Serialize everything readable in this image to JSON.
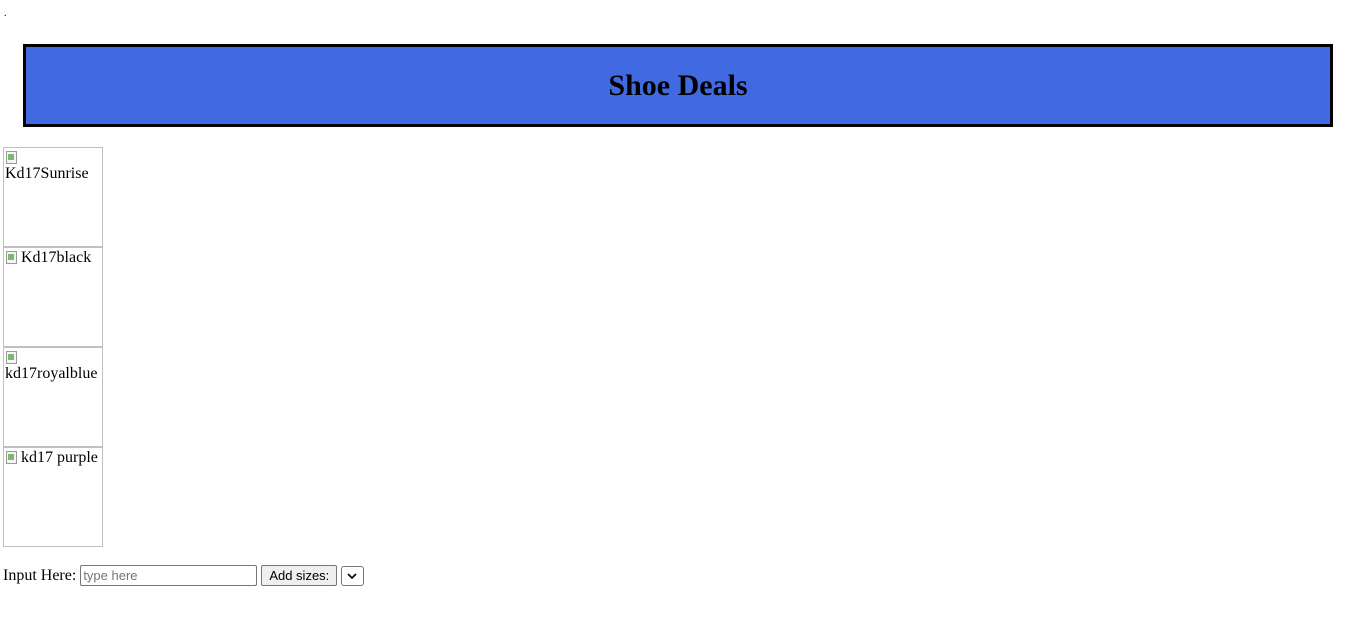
{
  "top_marker": ".",
  "header": {
    "title": "Shoe Deals",
    "background": "#4169e1"
  },
  "gallery": {
    "images": [
      {
        "alt": "Kd17Sunrise"
      },
      {
        "alt": "Kd17black"
      },
      {
        "alt": "kd17royalblue"
      },
      {
        "alt": "kd17 purple"
      }
    ]
  },
  "form": {
    "label": "Input Here:",
    "input_value": "",
    "input_placeholder": "type here",
    "button_label": "Add sizes:",
    "select_value": ""
  },
  "icons": {
    "broken_image": "broken-image-icon",
    "select_arrow": "chevron-down-icon"
  }
}
